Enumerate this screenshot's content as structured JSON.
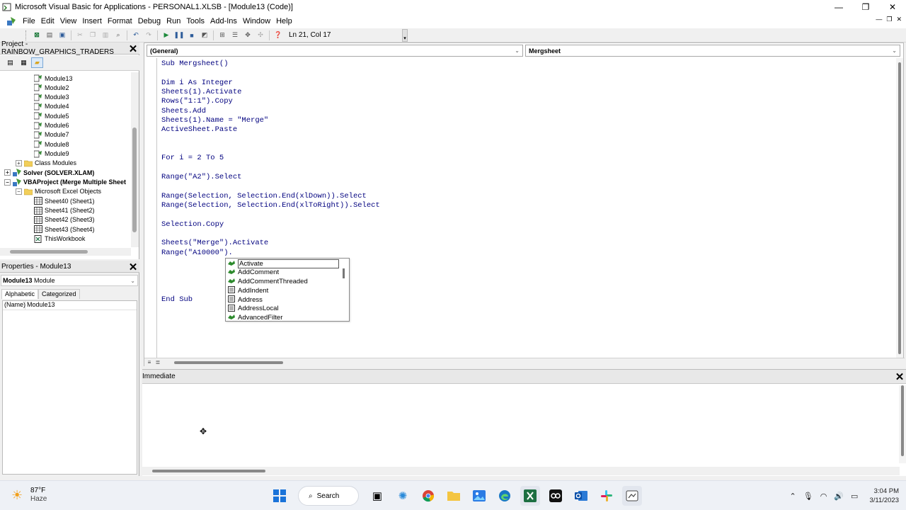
{
  "window": {
    "title": "Microsoft Visual Basic for Applications - PERSONAL1.XLSB - [Module13 (Code)]",
    "min_glyph": "—",
    "max_glyph": "❐",
    "close_glyph": "✕"
  },
  "menu": {
    "items": [
      "File",
      "Edit",
      "View",
      "Insert",
      "Format",
      "Debug",
      "Run",
      "Tools",
      "Add-Ins",
      "Window",
      "Help"
    ],
    "mdi": [
      "—",
      "❐",
      "✕"
    ]
  },
  "toolbar": {
    "cursor_position": "Ln 21, Col 17"
  },
  "project_panel": {
    "title": "Project - RAINBOW_GRAPHICS_TRADERS",
    "close_glyph": "✕",
    "tree": [
      {
        "label": "Module13",
        "type": "module",
        "indent": 48
      },
      {
        "label": "Module2",
        "type": "module",
        "indent": 48
      },
      {
        "label": "Module3",
        "type": "module",
        "indent": 48
      },
      {
        "label": "Module4",
        "type": "module",
        "indent": 48
      },
      {
        "label": "Module5",
        "type": "module",
        "indent": 48
      },
      {
        "label": "Module6",
        "type": "module",
        "indent": 48
      },
      {
        "label": "Module7",
        "type": "module",
        "indent": 48
      },
      {
        "label": "Module8",
        "type": "module",
        "indent": 48
      },
      {
        "label": "Module9",
        "type": "module",
        "indent": 48
      },
      {
        "label": "Class Modules",
        "type": "folder",
        "indent": 22,
        "expander": "+"
      },
      {
        "label": "Solver (SOLVER.XLAM)",
        "type": "project",
        "indent": 6,
        "expander": "+",
        "bold": true
      },
      {
        "label": "VBAProject (Merge Multiple Sheet",
        "type": "project",
        "indent": 6,
        "expander": "−",
        "bold": true
      },
      {
        "label": "Microsoft Excel Objects",
        "type": "folder",
        "indent": 22,
        "expander": "−"
      },
      {
        "label": "Sheet40 (Sheet1)",
        "type": "sheet",
        "indent": 48
      },
      {
        "label": "Sheet41 (Sheet2)",
        "type": "sheet",
        "indent": 48
      },
      {
        "label": "Sheet42 (Sheet3)",
        "type": "sheet",
        "indent": 48
      },
      {
        "label": "Sheet43 (Sheet4)",
        "type": "sheet",
        "indent": 48
      },
      {
        "label": "ThisWorkbook",
        "type": "workbook",
        "indent": 48
      }
    ]
  },
  "properties_panel": {
    "title": "Properties - Module13",
    "close_glyph": "✕",
    "object_name": "Module13",
    "object_type": "Module",
    "tabs": [
      "Alphabetic",
      "Categorized"
    ],
    "rows": [
      {
        "key": "(Name)",
        "value": "Module13"
      }
    ]
  },
  "code_window": {
    "object_combo": "(General)",
    "proc_combo": "Mergsheet",
    "lines": [
      "Sub Mergsheet()",
      "",
      "Dim i As Integer",
      "Sheets(1).Activate",
      "Rows(\"1:1\").Copy",
      "Sheets.Add",
      "Sheets(1).Name = \"Merge\"",
      "ActiveSheet.Paste",
      "",
      "",
      "For i = 2 To 5",
      "",
      "Range(\"A2\").Select",
      "",
      "Range(Selection, Selection.End(xlDown)).Select",
      "Range(Selection, Selection.End(xlToRight)).Select",
      "",
      "Selection.Copy",
      "",
      "Sheets(\"Merge\").Activate",
      "Range(\"A10000\").",
      "",
      "",
      "",
      "",
      "End Sub"
    ]
  },
  "intellisense": {
    "items": [
      {
        "label": "Activate",
        "kind": "method",
        "selected": true
      },
      {
        "label": "AddComment",
        "kind": "method"
      },
      {
        "label": "AddCommentThreaded",
        "kind": "method"
      },
      {
        "label": "AddIndent",
        "kind": "property"
      },
      {
        "label": "Address",
        "kind": "property"
      },
      {
        "label": "AddressLocal",
        "kind": "property"
      },
      {
        "label": "AdvancedFilter",
        "kind": "method"
      }
    ]
  },
  "immediate": {
    "title": "Immediate",
    "close_glyph": "✕"
  },
  "taskbar": {
    "temperature": "87°F",
    "condition": "Haze",
    "search_label": "Search",
    "time": "3:04 PM",
    "date": "3/11/2023"
  }
}
